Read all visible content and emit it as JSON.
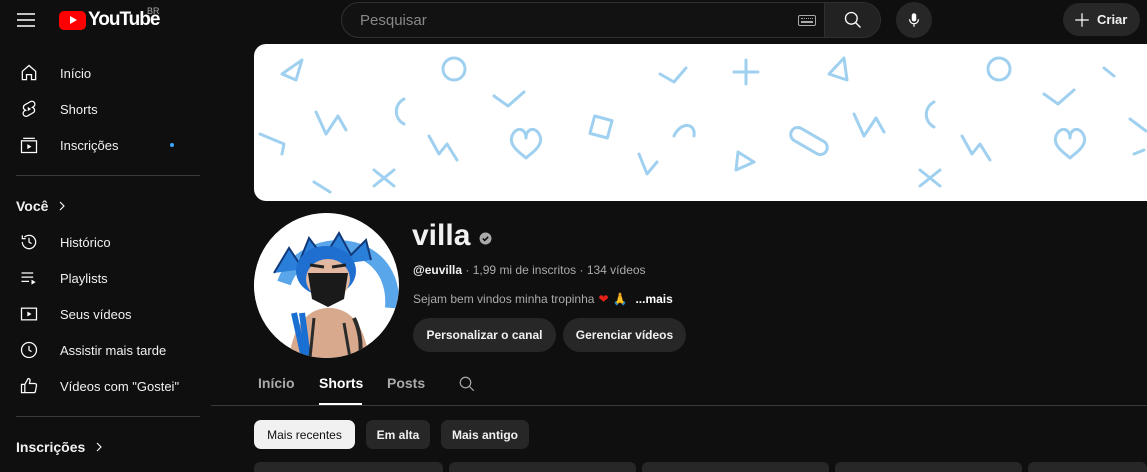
{
  "header": {
    "logo_text": "YouTube",
    "country_code": "BR",
    "search_placeholder": "Pesquisar",
    "create_label": "Criar"
  },
  "sidebar": {
    "main_items": [
      {
        "label": "Início",
        "icon": "home-icon"
      },
      {
        "label": "Shorts",
        "icon": "shorts-icon"
      },
      {
        "label": "Inscrições",
        "icon": "subscriptions-icon",
        "has_new": true
      }
    ],
    "you_title": "Você",
    "you_items": [
      {
        "label": "Histórico",
        "icon": "history-icon"
      },
      {
        "label": "Playlists",
        "icon": "playlists-icon"
      },
      {
        "label": "Seus vídeos",
        "icon": "your-videos-icon"
      },
      {
        "label": "Assistir mais tarde",
        "icon": "watch-later-icon"
      },
      {
        "label": "Vídeos com \"Gostei\"",
        "icon": "like-icon"
      }
    ],
    "subscriptions_title": "Inscrições"
  },
  "channel": {
    "name": "villa",
    "handle": "@euvilla",
    "subscribers": "1,99 mi de inscritos",
    "videos": "134 vídeos",
    "description": "Sejam bem vindos minha tropinha",
    "more_label": "...mais",
    "customize_label": "Personalizar o canal",
    "manage_label": "Gerenciar vídeos"
  },
  "tabs": [
    "Início",
    "Shorts",
    "Posts"
  ],
  "active_tab": "Shorts",
  "chips": [
    "Mais recentes",
    "Em alta",
    "Mais antigo"
  ],
  "selected_chip": "Mais recentes",
  "colors": {
    "brand": "#ff0000",
    "background": "#0f0f0f",
    "banner_pattern": "#9fd0f0",
    "dot": "#3ea6ff"
  }
}
